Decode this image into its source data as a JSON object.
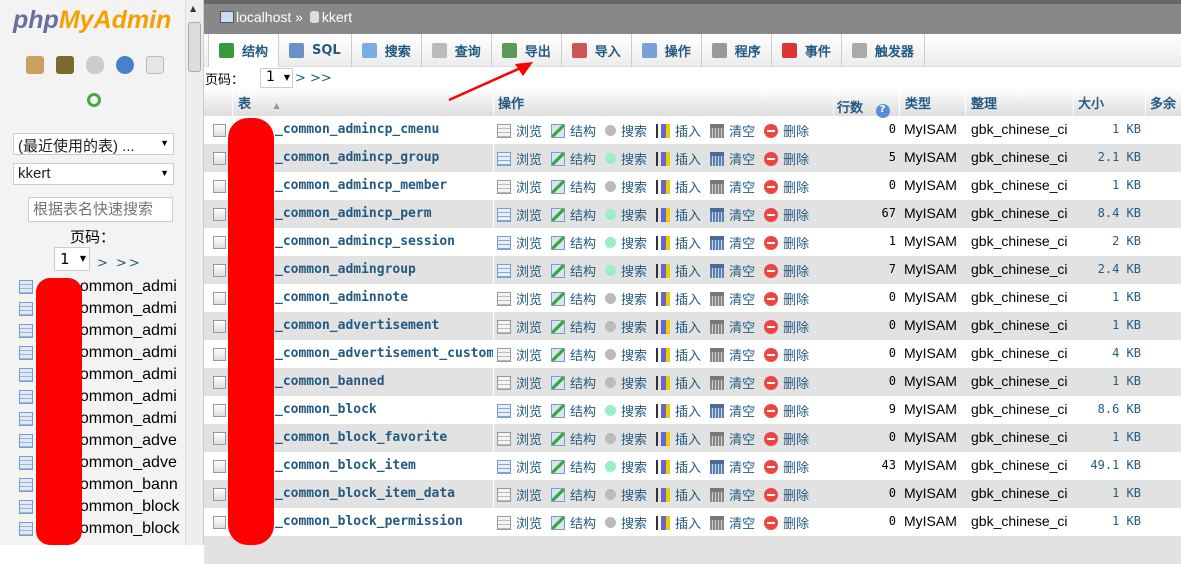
{
  "sidebar": {
    "logo": {
      "php": "php",
      "myadmin": "MyAdmin"
    },
    "icons": [
      "home-icon",
      "logout-icon",
      "sql-query-icon",
      "help-icon",
      "docs-icon",
      "reload-icon"
    ],
    "recent_tables": "(最近使用的表) ...",
    "database": "kkert",
    "filter_placeholder": "根据表名快速搜索",
    "page_label": "页码：",
    "page": "1",
    "next": ">  >>",
    "tables": [
      "_common_admi",
      "_common_admi",
      "_common_admi",
      "_common_admi",
      "_common_admi",
      "_common_admi",
      "_common_admi",
      "_common_adve",
      "_common_adve",
      "_common_bann",
      "_common_block",
      "_common_block"
    ]
  },
  "breadcrumb": {
    "server": "localhost",
    "separator": "»",
    "database": "kkert"
  },
  "tabs": [
    {
      "label": "结构",
      "icon": "structure-icon",
      "color": "#3a9a3a"
    },
    {
      "label": "SQL",
      "icon": "sql-icon",
      "color": "#6b8fc7"
    },
    {
      "label": "搜索",
      "icon": "search-icon",
      "color": "#7aaee0"
    },
    {
      "label": "查询",
      "icon": "query-icon",
      "color": "#bbbbbb"
    },
    {
      "label": "导出",
      "icon": "export-icon",
      "color": "#5a9a5a"
    },
    {
      "label": "导入",
      "icon": "import-icon",
      "color": "#c55"
    },
    {
      "label": "操作",
      "icon": "wrench-icon",
      "color": "#7aa0d8"
    },
    {
      "label": "程序",
      "icon": "routines-icon",
      "color": "#999"
    },
    {
      "label": "事件",
      "icon": "events-icon",
      "color": "#d33"
    },
    {
      "label": "触发器",
      "icon": "triggers-icon",
      "color": "#aaa"
    }
  ],
  "pager": {
    "label": "页码：",
    "page": "1",
    "next": "> >>"
  },
  "table_header": {
    "table": "表",
    "sort": "▲",
    "actions": "操作",
    "rows": "行数",
    "help": "?",
    "type": "类型",
    "collation": "整理",
    "size": "大小",
    "overhead": "多余"
  },
  "actions": {
    "browse": "浏览",
    "structure": "结构",
    "search": "搜索",
    "insert": "插入",
    "empty": "清空",
    "drop": "删除"
  },
  "rows": [
    {
      "name": "_common_admincp_cmenu",
      "rows": "0",
      "type": "MyISAM",
      "collation": "gbk_chinese_ci",
      "size": "1 KB"
    },
    {
      "name": "_common_admincp_group",
      "rows": "5",
      "type": "MyISAM",
      "collation": "gbk_chinese_ci",
      "size": "2.1 KB"
    },
    {
      "name": "_common_admincp_member",
      "rows": "0",
      "type": "MyISAM",
      "collation": "gbk_chinese_ci",
      "size": "1 KB"
    },
    {
      "name": "_common_admincp_perm",
      "rows": "67",
      "type": "MyISAM",
      "collation": "gbk_chinese_ci",
      "size": "8.4 KB"
    },
    {
      "name": "_common_admincp_session",
      "rows": "1",
      "type": "MyISAM",
      "collation": "gbk_chinese_ci",
      "size": "2 KB"
    },
    {
      "name": "_common_admingroup",
      "rows": "7",
      "type": "MyISAM",
      "collation": "gbk_chinese_ci",
      "size": "2.4 KB"
    },
    {
      "name": "_common_adminnote",
      "rows": "0",
      "type": "MyISAM",
      "collation": "gbk_chinese_ci",
      "size": "1 KB"
    },
    {
      "name": "_common_advertisement",
      "rows": "0",
      "type": "MyISAM",
      "collation": "gbk_chinese_ci",
      "size": "1 KB"
    },
    {
      "name": "_common_advertisement_custom",
      "rows": "0",
      "type": "MyISAM",
      "collation": "gbk_chinese_ci",
      "size": "4 KB"
    },
    {
      "name": "_common_banned",
      "rows": "0",
      "type": "MyISAM",
      "collation": "gbk_chinese_ci",
      "size": "1 KB"
    },
    {
      "name": "_common_block",
      "rows": "9",
      "type": "MyISAM",
      "collation": "gbk_chinese_ci",
      "size": "8.6 KB"
    },
    {
      "name": "_common_block_favorite",
      "rows": "0",
      "type": "MyISAM",
      "collation": "gbk_chinese_ci",
      "size": "1 KB"
    },
    {
      "name": "_common_block_item",
      "rows": "43",
      "type": "MyISAM",
      "collation": "gbk_chinese_ci",
      "size": "49.1 KB"
    },
    {
      "name": "_common_block_item_data",
      "rows": "0",
      "type": "MyISAM",
      "collation": "gbk_chinese_ci",
      "size": "1 KB"
    },
    {
      "name": "_common_block_permission",
      "rows": "0",
      "type": "MyISAM",
      "collation": "gbk_chinese_ci",
      "size": "1 KB"
    }
  ],
  "colors": {
    "link": "#235a81",
    "even_row": "#e2e2e2",
    "redaction": "#ff0000",
    "arrow": "#ff0000"
  }
}
